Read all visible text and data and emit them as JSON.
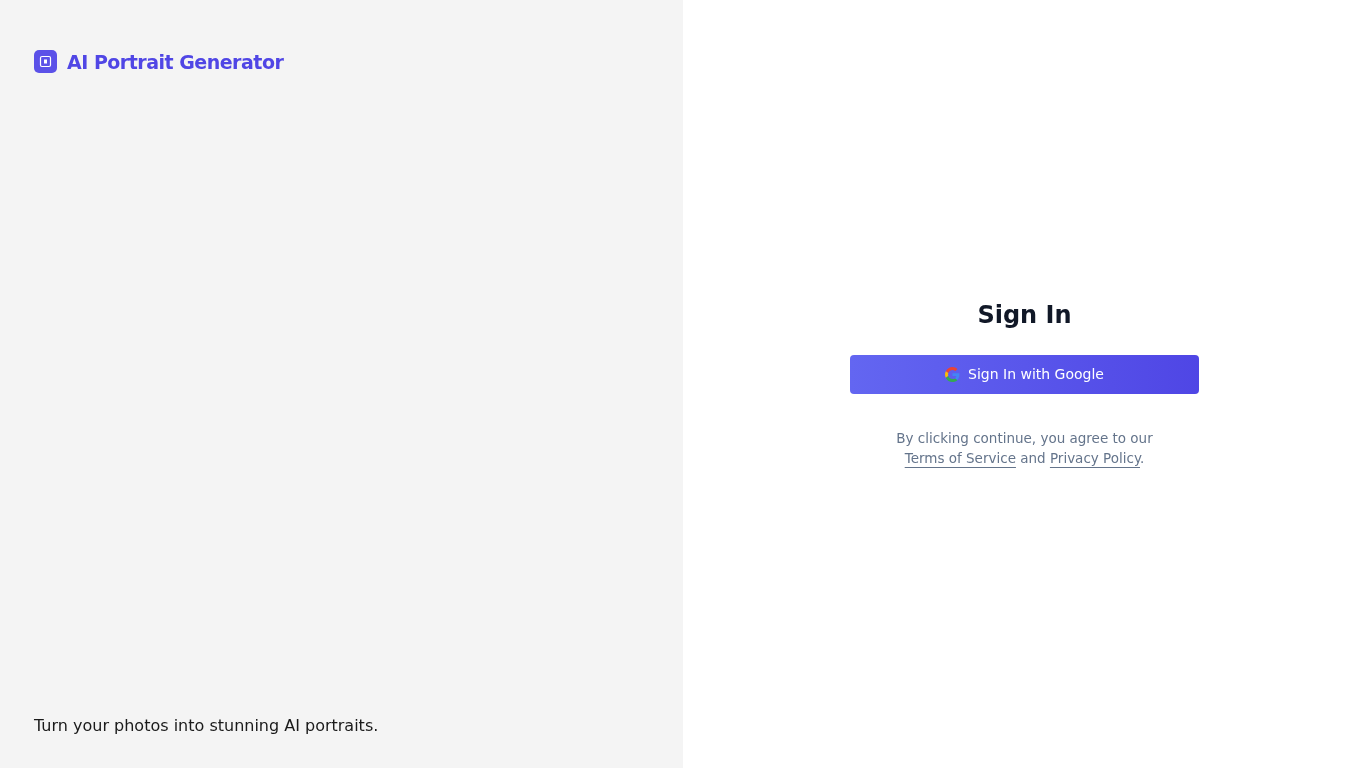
{
  "brand": {
    "title": "AI Portrait Generator"
  },
  "tagline": "Turn your photos into stunning AI portraits.",
  "sign_in": {
    "heading": "Sign In",
    "button": "Sign In with Google",
    "legal": {
      "before": "By clicking continue, you agree to our ",
      "terms_link": "Terms of Service",
      "middle": " and ",
      "privacy_link": "Privacy Policy",
      "after": "."
    }
  }
}
